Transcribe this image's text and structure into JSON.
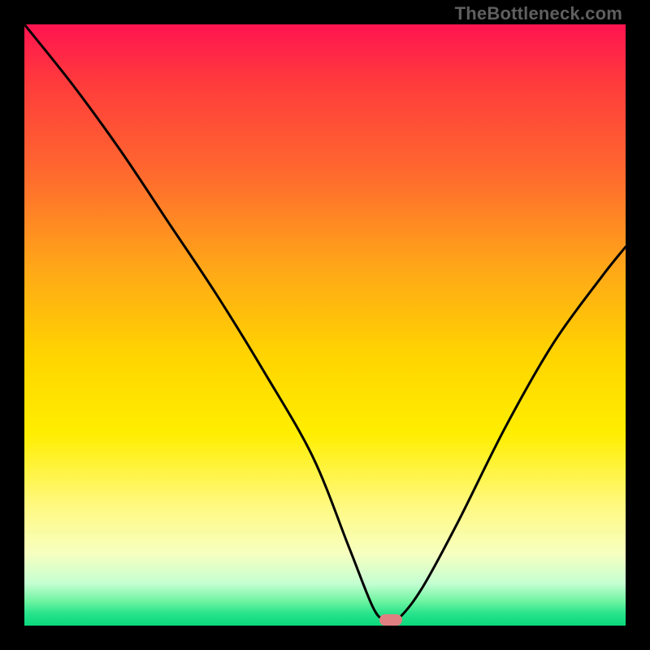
{
  "watermark": "TheBottleneck.com",
  "chart_data": {
    "type": "line",
    "title": "",
    "xlabel": "",
    "ylabel": "",
    "xlim": [
      0,
      100
    ],
    "ylim": [
      0,
      100
    ],
    "grid": false,
    "legend": false,
    "series": [
      {
        "name": "bottleneck-curve",
        "x": [
          0,
          8,
          16,
          24,
          32,
          40,
          48,
          54,
          58,
          60,
          62,
          66,
          72,
          80,
          88,
          96,
          100
        ],
        "values": [
          100,
          90,
          79,
          67,
          55,
          42,
          28,
          13,
          3,
          1,
          1,
          6,
          17,
          33,
          47,
          58,
          63
        ]
      }
    ],
    "marker": {
      "x": 61,
      "y": 1
    },
    "gradient_stops": [
      {
        "pos": 0,
        "color": "#ff1450"
      },
      {
        "pos": 25,
        "color": "#ff6a2e"
      },
      {
        "pos": 55,
        "color": "#ffd400"
      },
      {
        "pos": 80,
        "color": "#fff980"
      },
      {
        "pos": 96,
        "color": "#6cf3a0"
      },
      {
        "pos": 100,
        "color": "#0ad97c"
      }
    ]
  }
}
